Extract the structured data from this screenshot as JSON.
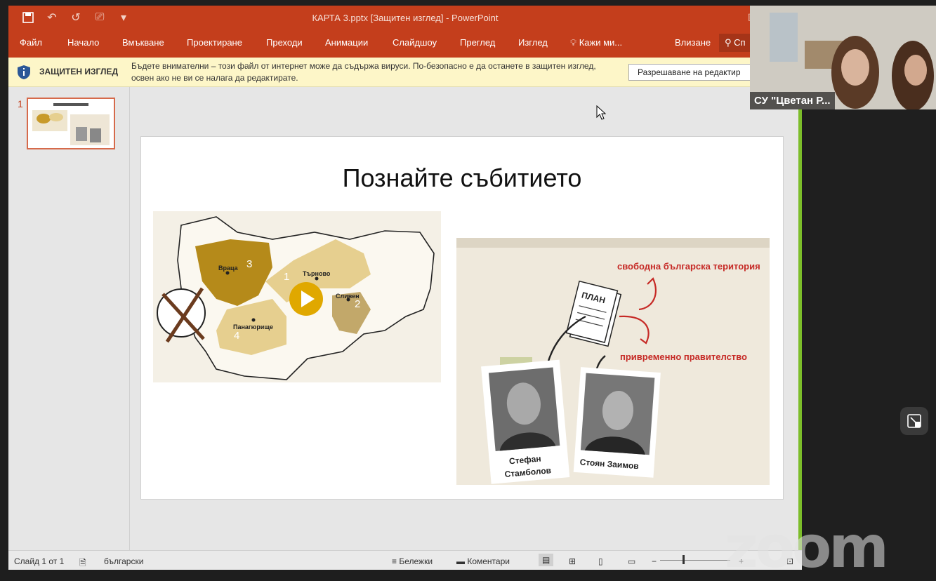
{
  "window": {
    "title": "КАРТА 3.pptx [Защитен изглед] - PowerPoint"
  },
  "ribbon": {
    "tabs": [
      "Файл",
      "Начало",
      "Вмъкване",
      "Проектиране",
      "Преходи",
      "Анимации",
      "Слайдшоу",
      "Преглед",
      "Изглед",
      "Кажи ми...",
      "Влизане",
      "Сп"
    ]
  },
  "protected_view": {
    "title": "ЗАЩИТЕН ИЗГЛЕД",
    "message": "Бъдете внимателни – този файл от интернет може да съдържа вируси. По-безопасно е да останете в защитен изглед, освен ако не ви се налага да редактирате.",
    "enable_button": "Разрешаване на редактир"
  },
  "thumbnails": {
    "number": "1"
  },
  "slide": {
    "title": "Познайте събитието",
    "map": {
      "labels": {
        "vratsa": "Враца",
        "tarnovo": "Търново",
        "sliven": "Сливен",
        "panagyurishte": "Панагюрище"
      },
      "numbers": [
        "1",
        "2",
        "3",
        "4"
      ]
    },
    "photo": {
      "territory": "свободна българска територия",
      "government": "привременно правителство",
      "plan": "ПЛАН",
      "person1_line1": "Стефан",
      "person1_line2": "Стамболов",
      "person2": "Стоян Заимов"
    }
  },
  "statusbar": {
    "slide_info": "Слайд 1 от 1",
    "language": "български",
    "notes": "Бележки",
    "comments": "Коментари"
  },
  "video": {
    "participant": "СУ \"Цветан Р..."
  },
  "overlay": {
    "zoom_watermark": "zoom"
  },
  "colors": {
    "ppt_accent": "#c43e1c",
    "protected_bar": "#fdf6c8",
    "map_dark": "#b58a1a",
    "map_light": "#e6cf8f",
    "red_text": "#c62a26"
  }
}
